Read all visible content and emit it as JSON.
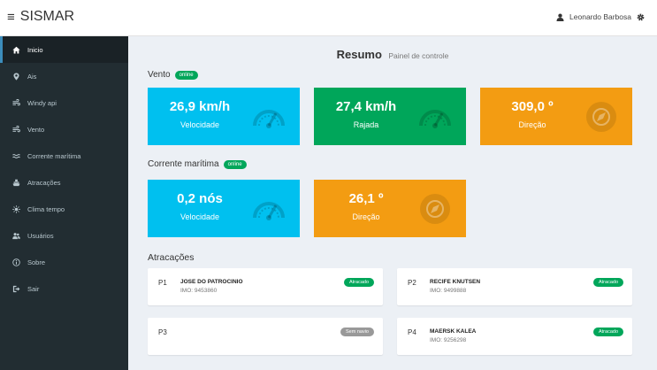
{
  "app": {
    "title": "SISMAR"
  },
  "user": {
    "name": "Leonardo Barbosa"
  },
  "sidebar": {
    "items": [
      {
        "label": "Inicio",
        "icon": "home-icon",
        "active": true
      },
      {
        "label": "Ais",
        "icon": "map-marker-icon"
      },
      {
        "label": "Windy api",
        "icon": "wind-icon"
      },
      {
        "label": "Vento",
        "icon": "wind-icon"
      },
      {
        "label": "Corrente marítima",
        "icon": "waves-icon"
      },
      {
        "label": "Atracações",
        "icon": "ship-icon"
      },
      {
        "label": "Clima tempo",
        "icon": "sun-icon"
      },
      {
        "label": "Usuários",
        "icon": "users-icon"
      },
      {
        "label": "Sobre",
        "icon": "info-icon"
      },
      {
        "label": "Sair",
        "icon": "sign-out-icon"
      }
    ]
  },
  "header": {
    "title": "Resumo",
    "subtitle": "Painel de controle"
  },
  "wind": {
    "title": "Vento",
    "status": "online",
    "speed": {
      "value": "26,9 km/h",
      "label": "Velocidade",
      "icon": "gauge-icon"
    },
    "gust": {
      "value": "27,4 km/h",
      "label": "Rajada",
      "icon": "gauge-icon"
    },
    "direction": {
      "value": "309,0 º",
      "label": "Direção",
      "icon": "compass-icon"
    }
  },
  "current": {
    "title": "Corrente marítima",
    "status": "online",
    "speed": {
      "value": "0,2 nós",
      "label": "Velocidade",
      "icon": "gauge-icon"
    },
    "direction": {
      "value": "26,1 º",
      "label": "Direção",
      "icon": "compass-icon"
    }
  },
  "berths": {
    "title": "Atracações",
    "items": [
      {
        "code": "P1",
        "ship": "JOSE DO PATROCINIO",
        "imo": "IMO: 9453860",
        "status": "Atracado"
      },
      {
        "code": "P2",
        "ship": "RECIFE KNUTSEN",
        "imo": "IMO: 9499888",
        "status": "Atracado"
      },
      {
        "code": "P3",
        "ship": "",
        "imo": "",
        "status": "Sem navio"
      },
      {
        "code": "P4",
        "ship": "MAERSK KALEA",
        "imo": "IMO: 9256298",
        "status": "Atracado"
      }
    ]
  },
  "colors": {
    "aqua": "#00c0ef",
    "green": "#00a65a",
    "orange": "#f39c12",
    "sidebar": "#222d32",
    "status_gray": "#999999"
  }
}
